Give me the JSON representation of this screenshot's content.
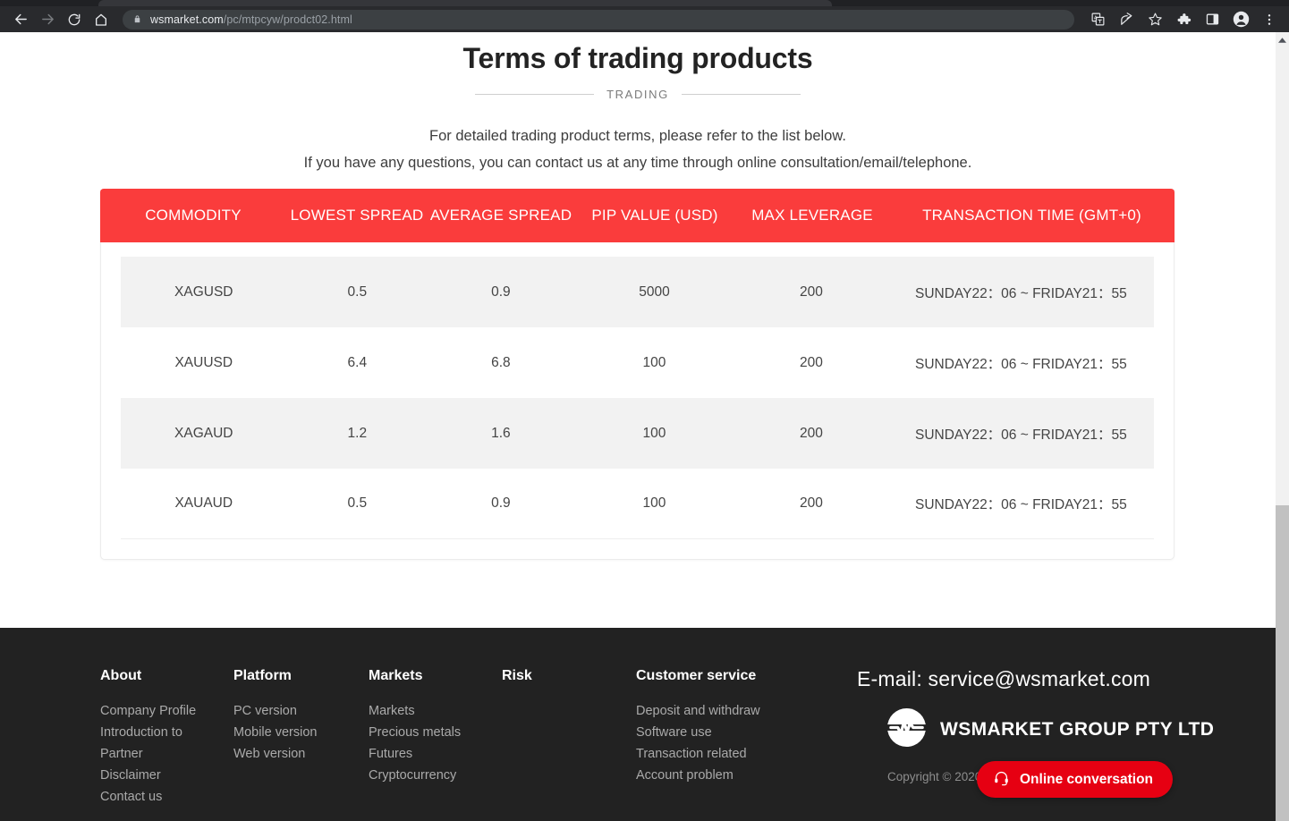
{
  "browser": {
    "omnibox": {
      "domain": "wsmarket.com",
      "path": "/pc/mtpcyw/prodct02.html"
    },
    "nav": {
      "back": "back-arrow-icon",
      "forward": "forward-arrow-icon",
      "reload": "reload-icon",
      "home": "home-icon"
    },
    "actions": [
      "translate-icon",
      "share-icon",
      "bookmark-star-icon",
      "extensions-puzzle-icon",
      "side-panel-icon",
      "profile-avatar-icon",
      "three-dot-menu-icon"
    ]
  },
  "page": {
    "title": "Terms of trading products",
    "subtitle": "TRADING",
    "intro_line1": "For detailed trading product terms, please refer to the list below.",
    "intro_line2": "If you have any questions, you can contact us at any time through online consultation/email/telephone."
  },
  "colors": {
    "table_header_red": "#fa3c3c",
    "chat_red": "#e60012",
    "footer_dark": "#222222",
    "row_stripe": "#f2f2f2"
  },
  "table": {
    "headers": [
      "COMMODITY",
      "LOWEST SPREAD",
      "AVERAGE SPREAD",
      "PIP VALUE (USD)",
      "MAX LEVERAGE",
      "TRANSACTION TIME (GMT+0)"
    ],
    "rows": [
      {
        "commodity": "XAGUSD",
        "lowest_spread": "0.5",
        "average_spread": "0.9",
        "pip_value": "5000",
        "max_leverage": "200",
        "transaction_time": "SUNDAY22：06 ~ FRIDAY21：55"
      },
      {
        "commodity": "XAUUSD",
        "lowest_spread": "6.4",
        "average_spread": "6.8",
        "pip_value": "100",
        "max_leverage": "200",
        "transaction_time": "SUNDAY22：06 ~ FRIDAY21：55"
      },
      {
        "commodity": "XAGAUD",
        "lowest_spread": "1.2",
        "average_spread": "1.6",
        "pip_value": "100",
        "max_leverage": "200",
        "transaction_time": "SUNDAY22：06 ~ FRIDAY21：55"
      },
      {
        "commodity": "XAUAUD",
        "lowest_spread": "0.5",
        "average_spread": "0.9",
        "pip_value": "100",
        "max_leverage": "200",
        "transaction_time": "SUNDAY22：06 ~ FRIDAY21：55"
      }
    ]
  },
  "footer": {
    "columns": [
      {
        "title": "About",
        "items": [
          "Company Profile",
          "Introduction to",
          "Partner",
          "Disclaimer",
          "Contact us"
        ]
      },
      {
        "title": "Platform",
        "items": [
          "PC version",
          "Mobile version",
          "Web version"
        ]
      },
      {
        "title": "Markets",
        "items": [
          "Markets",
          "Precious metals",
          "Futures",
          "Cryptocurrency"
        ]
      },
      {
        "title": "Risk",
        "items": []
      },
      {
        "title": "Customer service",
        "items": [
          "Deposit and withdraw",
          "Software use",
          "Transaction related",
          "Account problem"
        ]
      }
    ],
    "email": "E-mail: service@wsmarket.com",
    "brand": "WSMARKET GROUP PTY LTD",
    "brand_logo": "wsmarket-logo-icon",
    "copyright": "Copyright © 2020 WSMARKET G"
  },
  "chat": {
    "label": "Online conversation",
    "icon": "headset-icon"
  },
  "scrollbar": {
    "up_arrow": "scroll-up-arrow-icon"
  }
}
